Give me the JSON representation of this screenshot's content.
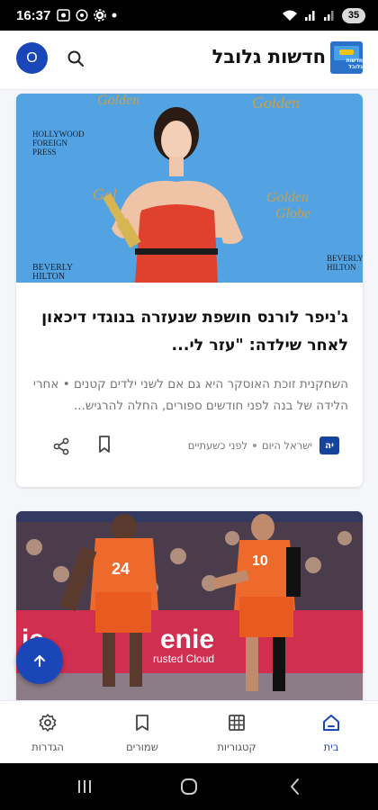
{
  "status_bar": {
    "time": "16:37",
    "battery": "35",
    "left_icons": [
      "gallery-icon",
      "whatsapp-icon",
      "settings-icon",
      "notification-dot"
    ],
    "right_icons": [
      "wifi-icon",
      "signal-icon",
      "signal-icon"
    ]
  },
  "header": {
    "avatar_letter": "O",
    "title": "חדשות גלובל",
    "logo_text": "חדשות גלובל",
    "accent_color": "#1a47b8"
  },
  "articles": [
    {
      "image_alt_brand_texts": [
        "HOLLYWOOD FOREIGN PRESS ASSOCIATION",
        "GOLDEN GLOBE",
        "THE BEVERLY HILTON"
      ],
      "headline": "ג'ניפר לורנס חושפת שנעזרה בנוגדי דיכאון לאחר שילדה: \"עזר לי...",
      "summary": "השחקנית זוכת האוסקר היא גם אם לשני ילדים קטנים • אחרי הלידה של בנה לפני חודשים ספורים, החלה להרגיש...",
      "source_badge": "יה",
      "source_name": "ישראל היום",
      "time_ago": "לפני כשעתיים"
    },
    {
      "image_alt_brand_texts": [
        "nie",
        "rusted Cloud",
        "24",
        "10"
      ],
      "headline": "",
      "summary": ""
    }
  ],
  "bottom_nav": [
    {
      "label": "בית",
      "icon": "home-icon",
      "active": true
    },
    {
      "label": "קטגוריות",
      "icon": "grid-icon",
      "active": false
    },
    {
      "label": "שמורים",
      "icon": "bookmark-icon",
      "active": false
    },
    {
      "label": "הגדרות",
      "icon": "gear-icon",
      "active": false
    }
  ]
}
